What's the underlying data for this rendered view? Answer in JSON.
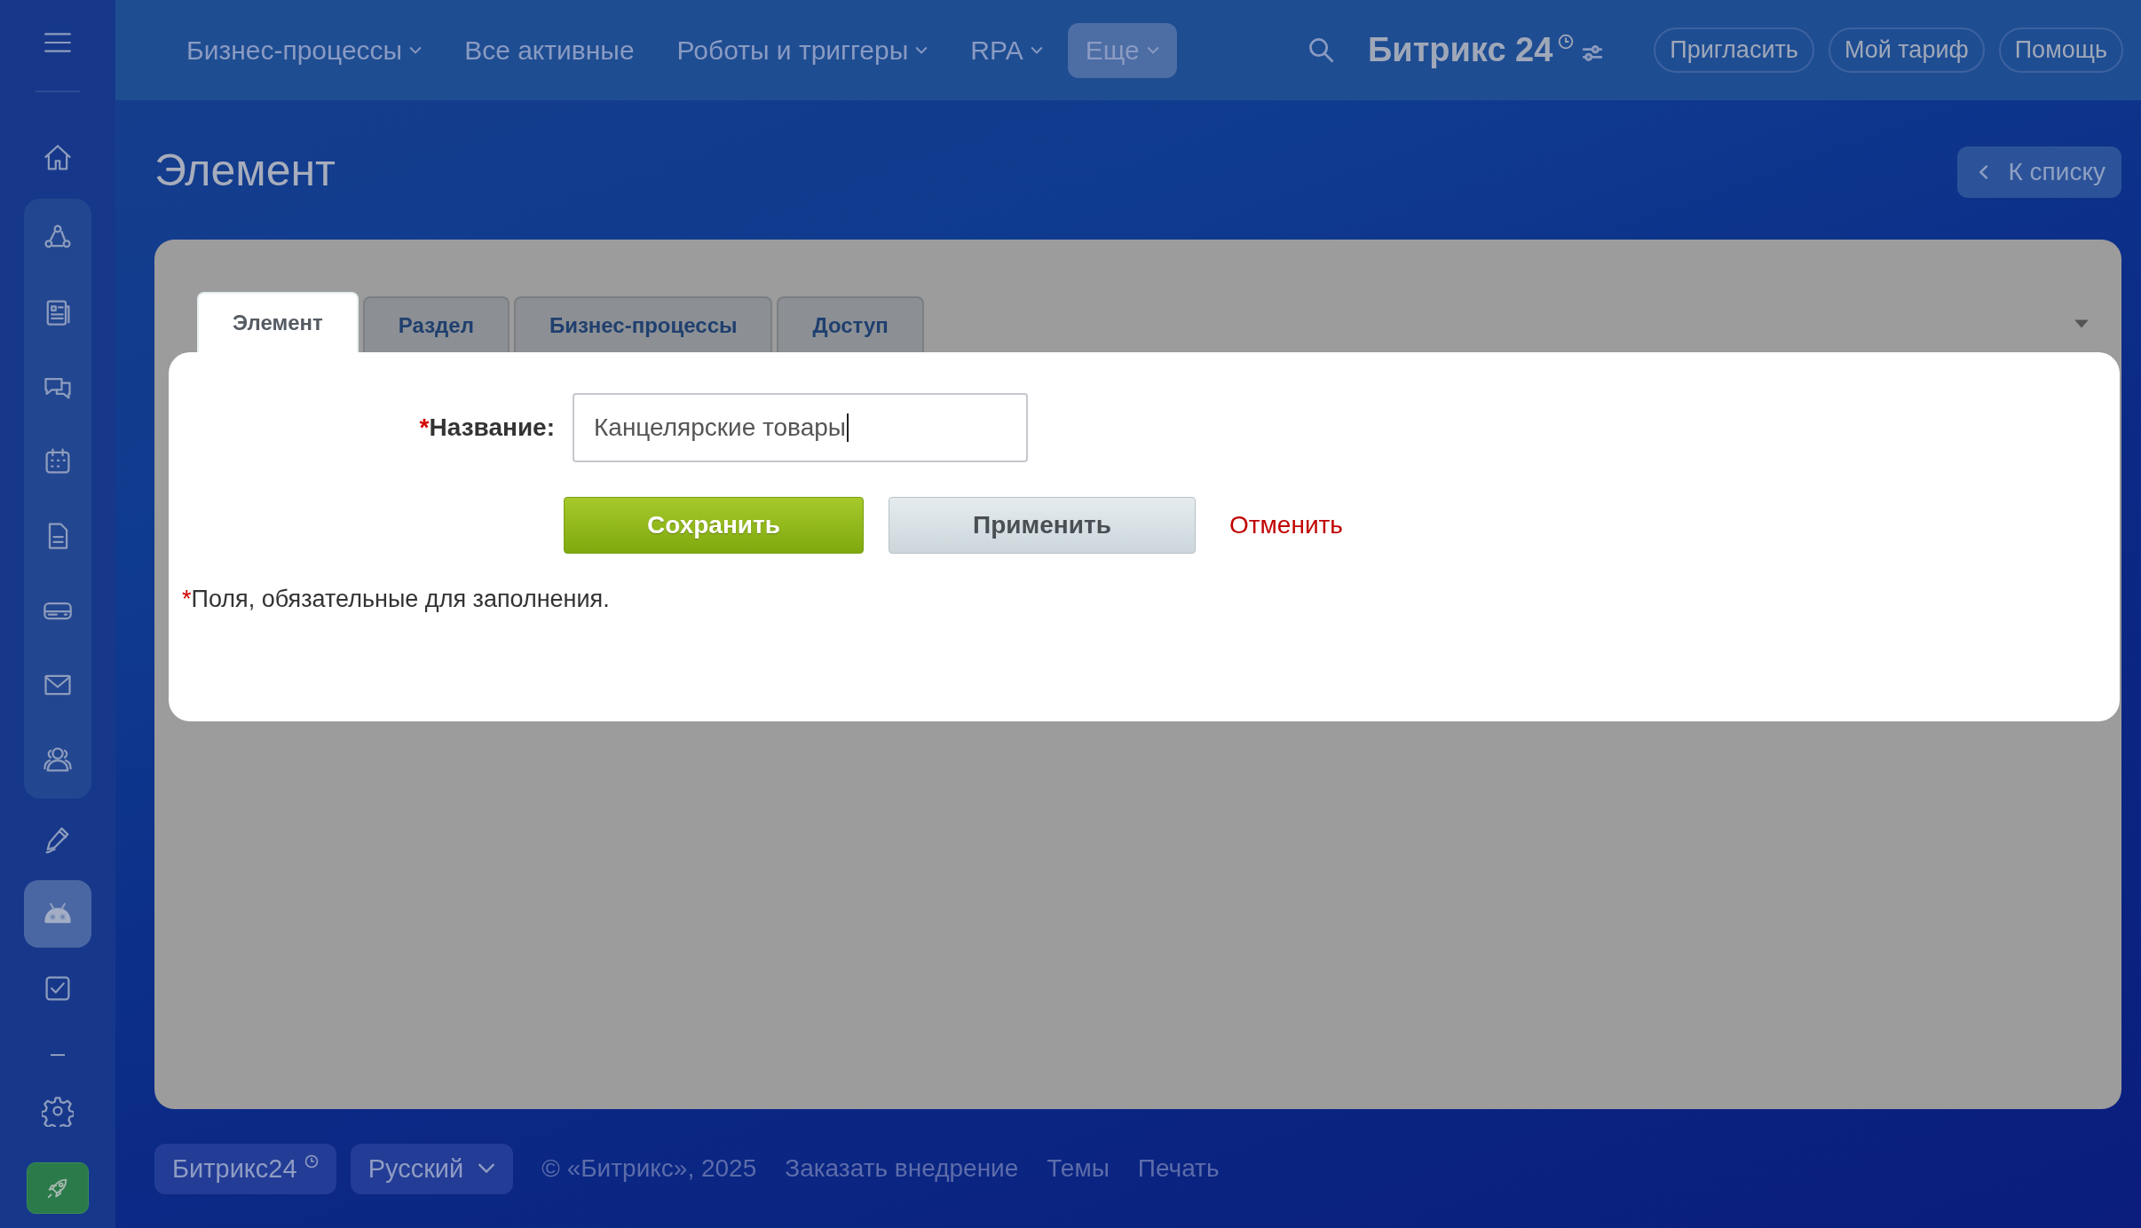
{
  "topbar": {
    "menu": [
      {
        "label": "Бизнес-процессы",
        "dropdown": true,
        "selected": false
      },
      {
        "label": "Все активные",
        "dropdown": false,
        "selected": false
      },
      {
        "label": "Роботы и триггеры",
        "dropdown": true,
        "selected": false
      },
      {
        "label": "RPA",
        "dropdown": true,
        "selected": false
      },
      {
        "label": "Еще",
        "dropdown": true,
        "selected": true
      }
    ],
    "logo": "Битрикс 24",
    "buttons": [
      "Пригласить",
      "Мой тариф",
      "Помощь"
    ]
  },
  "sidebar": {
    "sections": [
      {
        "items": [
          {
            "kind": "home",
            "selected": false
          }
        ]
      },
      {
        "items": [
          {
            "kind": "flow",
            "selected": false
          },
          {
            "kind": "news",
            "selected": false
          },
          {
            "kind": "chat",
            "selected": false
          },
          {
            "kind": "calendar",
            "selected": false
          },
          {
            "kind": "document",
            "selected": false
          },
          {
            "kind": "drive",
            "selected": false
          },
          {
            "kind": "mail",
            "selected": false
          },
          {
            "kind": "people",
            "selected": false
          }
        ]
      },
      {
        "items": [
          {
            "kind": "pen",
            "selected": false
          },
          {
            "kind": "robot",
            "selected": true
          },
          {
            "kind": "check",
            "selected": false
          }
        ]
      }
    ]
  },
  "page": {
    "title": "Элемент",
    "back": "К списку"
  },
  "tabs": [
    {
      "label": "Элемент",
      "selected": true
    },
    {
      "label": "Раздел",
      "selected": false
    },
    {
      "label": "Бизнес-процессы",
      "selected": false
    },
    {
      "label": "Доступ",
      "selected": false
    }
  ],
  "form": {
    "required_mark": "*",
    "label": "Название:",
    "value": "Канцелярские товары"
  },
  "buttons": [
    {
      "label": "Сохранить",
      "kind": "primary"
    },
    {
      "label": "Применить",
      "kind": "secondary"
    },
    {
      "label": "Отменить",
      "kind": "link"
    }
  ],
  "note": {
    "mark": "*",
    "text": "Поля, обязательные для заполнения."
  },
  "footer": {
    "logo": "Битрикс24",
    "language": "Русский",
    "copyright": "© «Битрикс», 2025",
    "links": [
      "Заказать внедрение",
      "Темы",
      "Печать"
    ]
  }
}
